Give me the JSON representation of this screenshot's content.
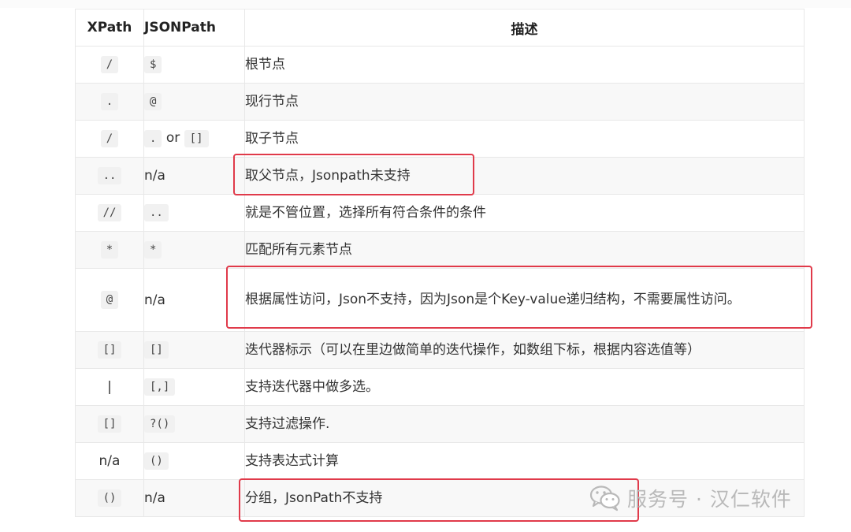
{
  "headers": {
    "xpath": "XPath",
    "jsonpath": "JSONPath",
    "desc": "描述"
  },
  "rows": [
    {
      "xpath": "/",
      "jsonpath": "$",
      "desc": "根节点"
    },
    {
      "xpath": ".",
      "jsonpath": "@",
      "desc": "现行节点"
    },
    {
      "xpath": "/",
      "jsonpath_a": ".",
      "jsonpath_or": "or",
      "jsonpath_b": "[]",
      "desc": "取子节点"
    },
    {
      "xpath": "..",
      "jsonpath": "n/a",
      "desc": "取父节点，Jsonpath未支持"
    },
    {
      "xpath": "//",
      "jsonpath": "..",
      "desc": "就是不管位置，选择所有符合条件的条件"
    },
    {
      "xpath": "*",
      "jsonpath": "*",
      "desc": "匹配所有元素节点"
    },
    {
      "xpath": "@",
      "jsonpath": "n/a",
      "desc": "根据属性访问，Json不支持，因为Json是个Key-value递归结构，不需要属性访问。"
    },
    {
      "xpath": "[]",
      "jsonpath": "[]",
      "desc": "迭代器标示（可以在里边做简单的迭代操作，如数组下标，根据内容选值等）"
    },
    {
      "xpath": "|",
      "jsonpath": "[,]",
      "desc": "支持迭代器中做多选。"
    },
    {
      "xpath": "[]",
      "jsonpath": "?()",
      "desc": "支持过滤操作."
    },
    {
      "xpath": "n/a",
      "jsonpath": "()",
      "desc": "支持表达式计算"
    },
    {
      "xpath": "()",
      "jsonpath": "n/a",
      "desc": "分组，JsonPath不支持"
    }
  ],
  "watermark": {
    "text": "服务号 · 汉仁软件",
    "icon": "wechat-icon"
  },
  "colors": {
    "callout": "#e03a4a",
    "row_alt": "#f8f8f8",
    "border": "#e8e8e8"
  }
}
